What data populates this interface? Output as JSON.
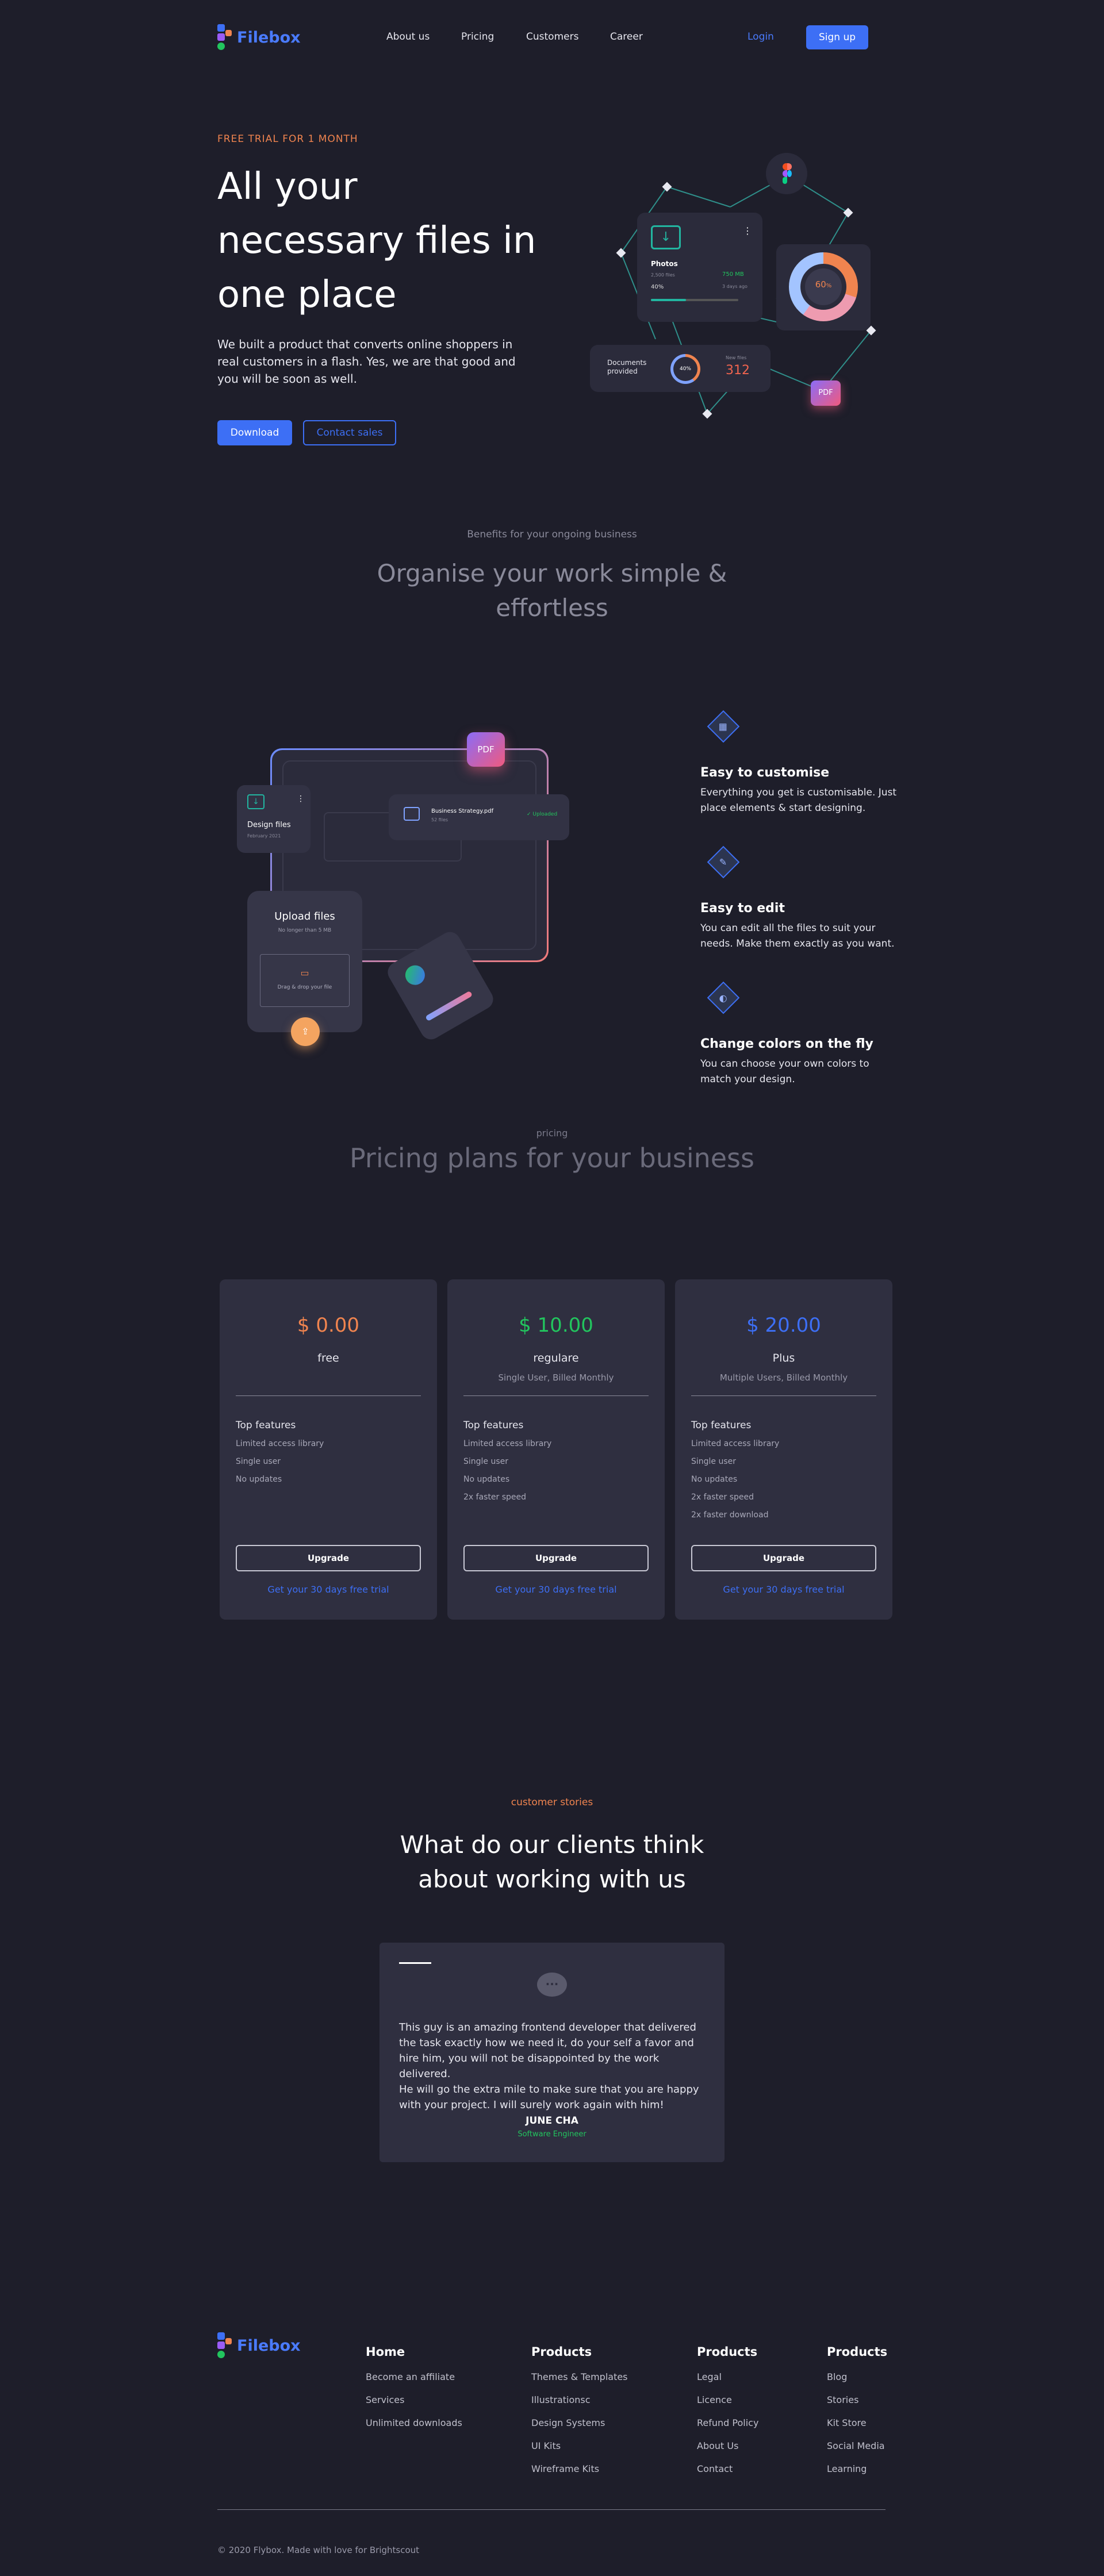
{
  "nav": {
    "brand": "Filebox",
    "links": [
      "About us",
      "Pricing",
      "Customers",
      "Career"
    ],
    "login": "Login",
    "signup": "Sign up"
  },
  "hero": {
    "eyebrow": "FREE TRIAL FOR 1 MONTH",
    "title_lines": [
      "All your",
      "necessary files in",
      "one place"
    ],
    "description_lines": [
      "We built a product that converts online shoppers in",
      "real customers in a flash. Yes, we are that good and",
      "you will be soon as well."
    ],
    "download": "Download",
    "contact": "Contact sales",
    "illustration": {
      "photos_label": "Photos",
      "photos_files": "2,500 files",
      "photos_size": "750 MB",
      "photos_percent": "40%",
      "photos_date": "3 days ago",
      "docs_label_1": "Documents",
      "docs_label_2": "provided",
      "docs_percent": "40%",
      "docs_small": "New files",
      "docs_count": "312",
      "ring_value": "60",
      "ring_percent": "%",
      "pdf": "PDF"
    }
  },
  "benefits": {
    "eyebrow": "Benefits for your ongoing business",
    "title_lines": [
      "Organise your work simple &",
      "effortless"
    ],
    "design_files": "Design files",
    "design_date": "February 2021",
    "doc_name": "Business Strategy.pdf",
    "doc_size": "52 files",
    "doc_status": "✓ Uploaded",
    "upload_title": "Upload files",
    "upload_sub": "No longer than 5 MB",
    "upload_drop": "Drag & drop your file",
    "pdf": "PDF",
    "features": [
      {
        "title": "Easy to customise",
        "text_lines": [
          "Everything you get is customisable. Just",
          "place elements & start designing."
        ],
        "icon": "grid-icon"
      },
      {
        "title": "Easy to edit",
        "text_lines": [
          "You can edit all the files to suit your",
          "needs. Make them exactly as you want."
        ],
        "icon": "pencil-icon"
      },
      {
        "title": "Change colors on the fly",
        "text_lines": [
          "You can choose your own colors to",
          "match your design."
        ],
        "icon": "palette-icon"
      }
    ]
  },
  "pricing": {
    "eyebrow": "pricing",
    "title": "Pricing plans for your business",
    "top_features": "Top features",
    "upgrade": "Upgrade",
    "trial": "Get your 30 days free trial",
    "plans": [
      {
        "price": "$ 0.00",
        "name": "free",
        "sub": "",
        "color": "#f0844f",
        "features": [
          "Limited access library",
          "Single user",
          "No updates"
        ]
      },
      {
        "price": "$ 10.00",
        "name": "regulare",
        "sub": "Single User, Billed Monthly",
        "color": "#22c55e",
        "features": [
          "Limited access library",
          "Single user",
          "No updates",
          "2x faster speed"
        ]
      },
      {
        "price": "$ 20.00",
        "name": "Plus",
        "sub": "Multiple Users, Billed Monthly",
        "color": "#3d6ff5",
        "features": [
          "Limited access library",
          "Single user",
          "No updates",
          "2x faster speed",
          "2x faster download"
        ]
      }
    ]
  },
  "testimonial": {
    "eyebrow": "customer stories",
    "title_lines": [
      "What do our clients think",
      "about working with us"
    ],
    "quote_lines": [
      "This guy is an amazing frontend developer that delivered",
      "the task exactly how we need it, do your self a favor and",
      "hire him, you will not be disappointed by the work delivered.",
      "He will go the extra mile to make sure that you are happy",
      "with your project. I will surely work again with him!"
    ],
    "name": "JUNE CHA",
    "role": "Software Engineer"
  },
  "footer": {
    "brand": "Filebox",
    "columns": [
      {
        "title": "Home",
        "links": [
          "Become an affiliate",
          "Services",
          "Unlimited downloads"
        ]
      },
      {
        "title": "Products",
        "links": [
          "Themes & Templates",
          "Illustrationsc",
          "Design Systems",
          "UI Kits",
          "Wireframe Kits"
        ]
      },
      {
        "title": "Products",
        "links": [
          "Legal",
          "Licence",
          "Refund Policy",
          "About Us",
          "Contact"
        ]
      },
      {
        "title": "Products",
        "links": [
          "Blog",
          "Stories",
          "Kit Store",
          "Social Media",
          "Learning"
        ]
      }
    ],
    "copyright": "© 2020 Flybox. Made with love for Brightscout"
  },
  "colors": {
    "accent": "#3d6ff5",
    "orange": "#f0844f",
    "green": "#22c55e",
    "background": "#1e1e2a"
  }
}
